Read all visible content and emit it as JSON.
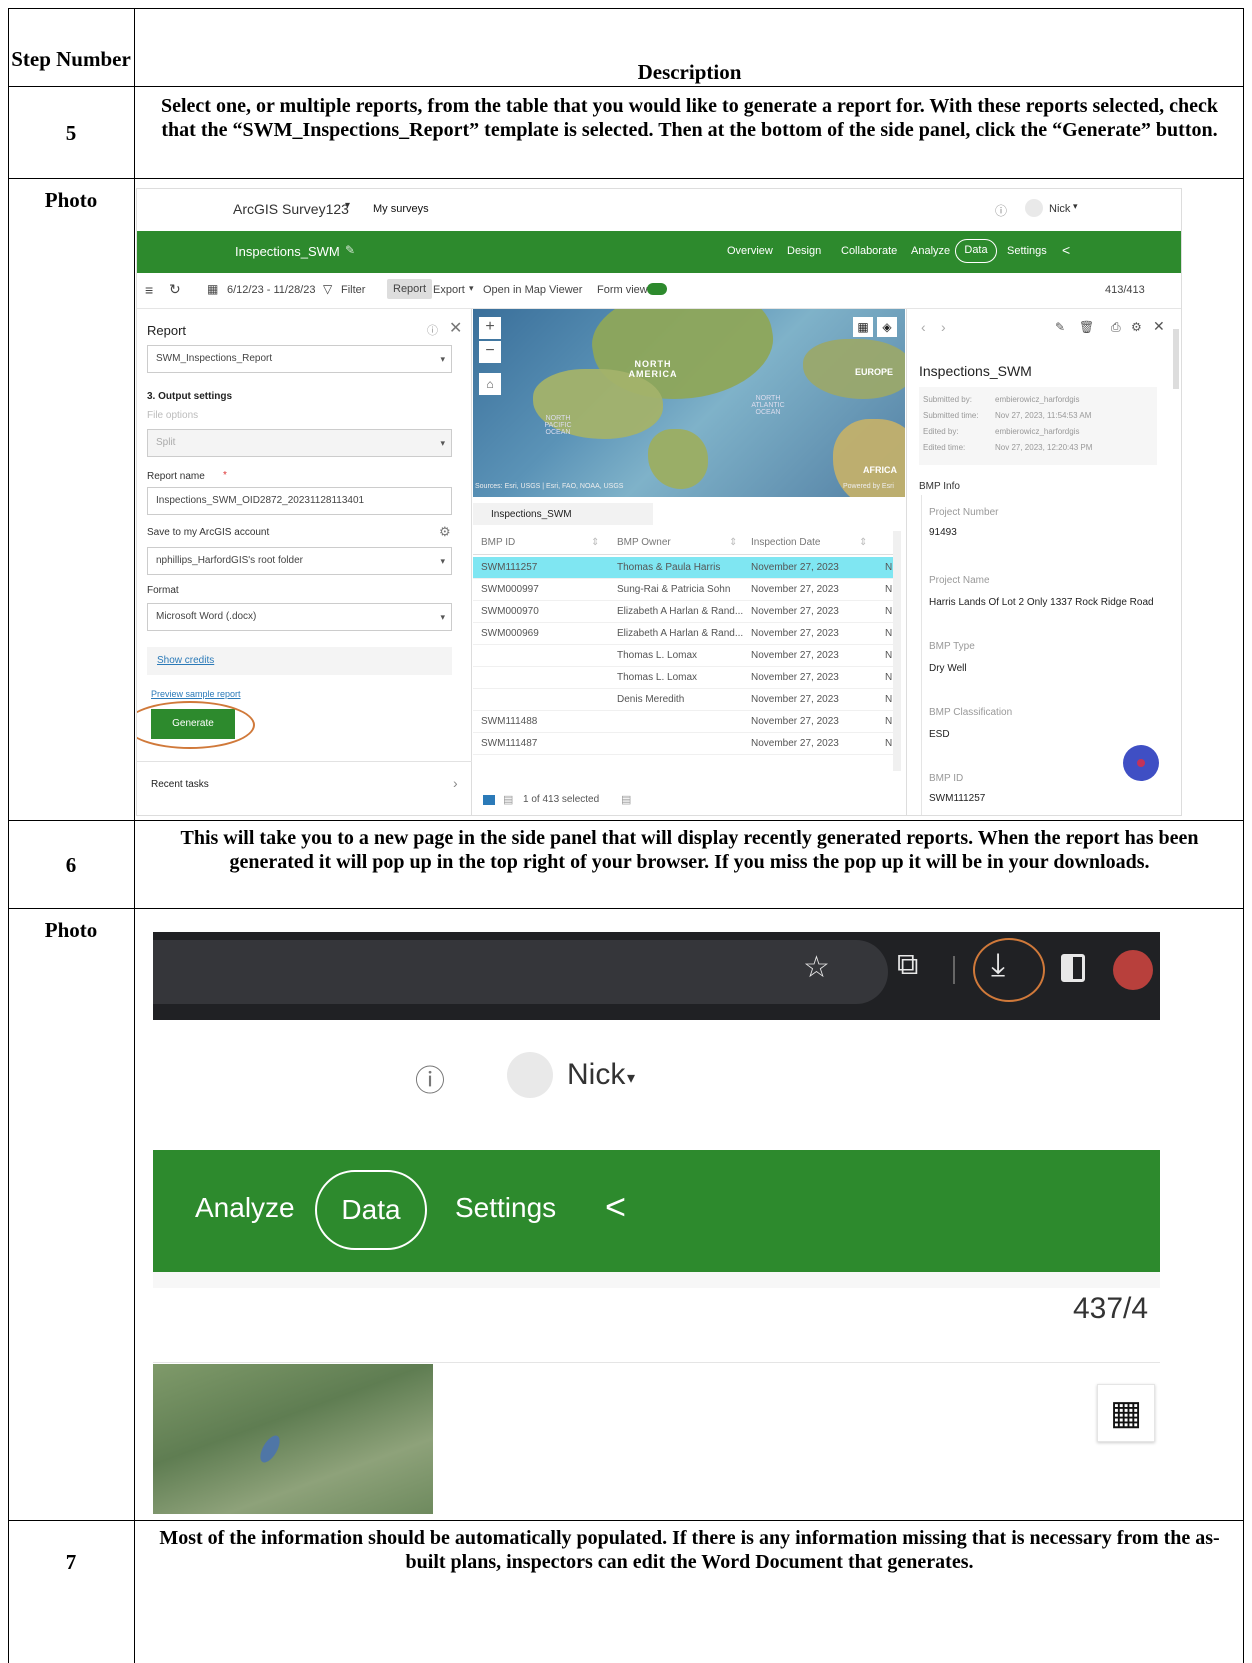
{
  "table": {
    "header_left": "Step Number",
    "header_right": "Description",
    "photo_label": "Photo",
    "rows": [
      {
        "step": "5",
        "text": "Select one, or multiple reports, from the table that you would like to generate a report for. With these reports selected, check that the “SWM_Inspections_Report” template is selected. Then at the bottom of the side panel, click the “Generate” button."
      },
      {
        "step": "6",
        "text": "This will take you to a new page in the side panel that will display recently generated reports. When the report has been generated it will pop up in the top right of your browser. If you miss the pop up it will be in your downloads."
      },
      {
        "step": "7",
        "text": "Most of the information should be automatically populated. If there is any information missing that is necessary from the as-built plans, inspectors can edit the Word Document that generates."
      }
    ]
  },
  "shot1": {
    "app_name": "ArcGIS Survey123",
    "my_surveys": "My surveys",
    "user": "Nick",
    "survey_name": "Inspections_SWM",
    "nav": [
      "Overview",
      "Design",
      "Collaborate",
      "Analyze",
      "Data",
      "Settings"
    ],
    "date_range": "6/12/23 - 11/28/23",
    "filter": "Filter",
    "report_btn": "Report",
    "export": "Export",
    "open_map": "Open in Map Viewer",
    "form_view": "Form view",
    "count": "413/413",
    "panel_title": "Report",
    "template": "SWM_Inspections_Report",
    "output_settings": "3. Output settings",
    "file_options": "File options",
    "split": "Split",
    "report_name_label": "Report name",
    "report_name": "Inspections_SWM_OID2872_20231128113401",
    "save_label": "Save to my ArcGIS account",
    "folder": "nphillips_HarfordGIS's root folder",
    "format_label": "Format",
    "format": "Microsoft Word (.docx)",
    "show_credits": "Show credits",
    "preview": "Preview sample report",
    "generate": "Generate",
    "recent_tasks": "Recent tasks",
    "map_labels": [
      "NORTH AMERICA",
      "EUROPE",
      "AFRICA",
      "NORTH ATLANTIC OCEAN",
      "NORTH PACIFIC OCEAN"
    ],
    "map_sources": "Sources: Esri, USGS | Esri, FAO, NOAA, USGS",
    "powered": "Powered by Esri",
    "table_tab": "Inspections_SWM",
    "columns": [
      "BMP ID",
      "BMP Owner",
      "Inspection Date"
    ],
    "rows": [
      {
        "id": "SWM111257",
        "owner": "Thomas & Paula Harris",
        "date": "November 27, 2023",
        "n": "N"
      },
      {
        "id": "SWM000997",
        "owner": "Sung-Rai & Patricia Sohn",
        "date": "November 27, 2023",
        "n": "N"
      },
      {
        "id": "SWM000970",
        "owner": "Elizabeth A Harlan & Rand...",
        "date": "November 27, 2023",
        "n": "N"
      },
      {
        "id": "SWM000969",
        "owner": "Elizabeth A Harlan & Rand...",
        "date": "November 27, 2023",
        "n": "N"
      },
      {
        "id": "",
        "owner": "Thomas L. Lomax",
        "date": "November 27, 2023",
        "n": "N"
      },
      {
        "id": "",
        "owner": "Thomas L. Lomax",
        "date": "November 27, 2023",
        "n": "N"
      },
      {
        "id": "",
        "owner": "Denis Meredith",
        "date": "November 27, 2023",
        "n": "N"
      },
      {
        "id": "SWM111488",
        "owner": "",
        "date": "November 27, 2023",
        "n": "N"
      },
      {
        "id": "SWM111487",
        "owner": "",
        "date": "November 27, 2023",
        "n": "N"
      }
    ],
    "selected_count": "1 of 413 selected",
    "detail_title": "Inspections_SWM",
    "submitted_by_label": "Submitted by:",
    "submitted_by": "embierowicz_harfordgis",
    "submitted_time_label": "Submitted time:",
    "submitted_time": "Nov 27, 2023, 11:54:53 AM",
    "edited_by_label": "Edited by:",
    "edited_by": "embierowicz_harfordgis",
    "edited_time_label": "Edited time:",
    "edited_time": "Nov 27, 2023, 12:20:43 PM",
    "bmp_info": "BMP Info",
    "project_number_label": "Project Number",
    "project_number": "91493",
    "project_name_label": "Project Name",
    "project_name": "Harris Lands Of Lot 2 Only 1337 Rock Ridge Road",
    "bmp_type_label": "BMP Type",
    "bmp_type": "Dry Well",
    "bmp_class_label": "BMP Classification",
    "bmp_class": "ESD",
    "bmp_id_label": "BMP ID",
    "bmp_id": "SWM111257"
  },
  "shot2": {
    "user": "Nick",
    "nav": [
      "Analyze",
      "Data",
      "Settings"
    ],
    "count": "437/4"
  },
  "colors": {
    "esri_green": "#2d8a2d",
    "highlight_circle": "#d0793a",
    "selected_row": "#7fe6f2"
  }
}
